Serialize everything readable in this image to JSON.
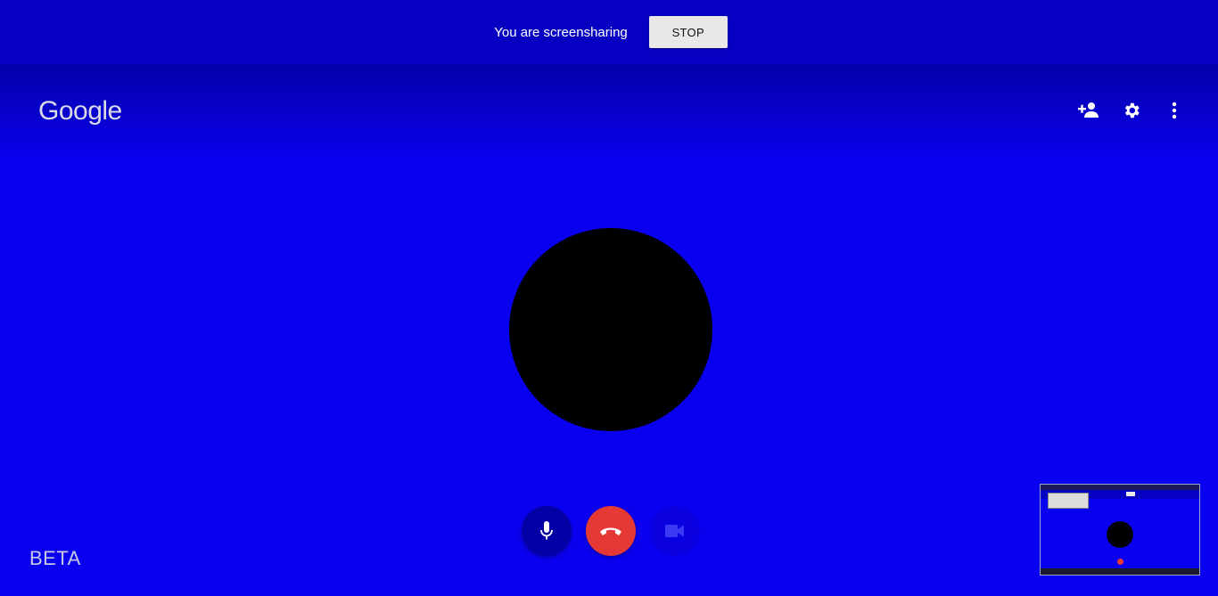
{
  "share_bar": {
    "message": "You are screensharing",
    "stop_label": "STOP"
  },
  "header": {
    "logo_text": "Google",
    "icons": [
      "add-person-icon",
      "gear-icon",
      "more-vert-icon"
    ]
  },
  "controls": {
    "icons": [
      "microphone-icon",
      "hang-up-icon",
      "video-camera-icon"
    ]
  },
  "footer": {
    "beta_label": "BETA"
  },
  "colors": {
    "background": "#0a00f0",
    "share_bar": "#0600c2",
    "hangup": "#e53935",
    "mic_button": "#0500a6",
    "avatar": "#000000"
  }
}
